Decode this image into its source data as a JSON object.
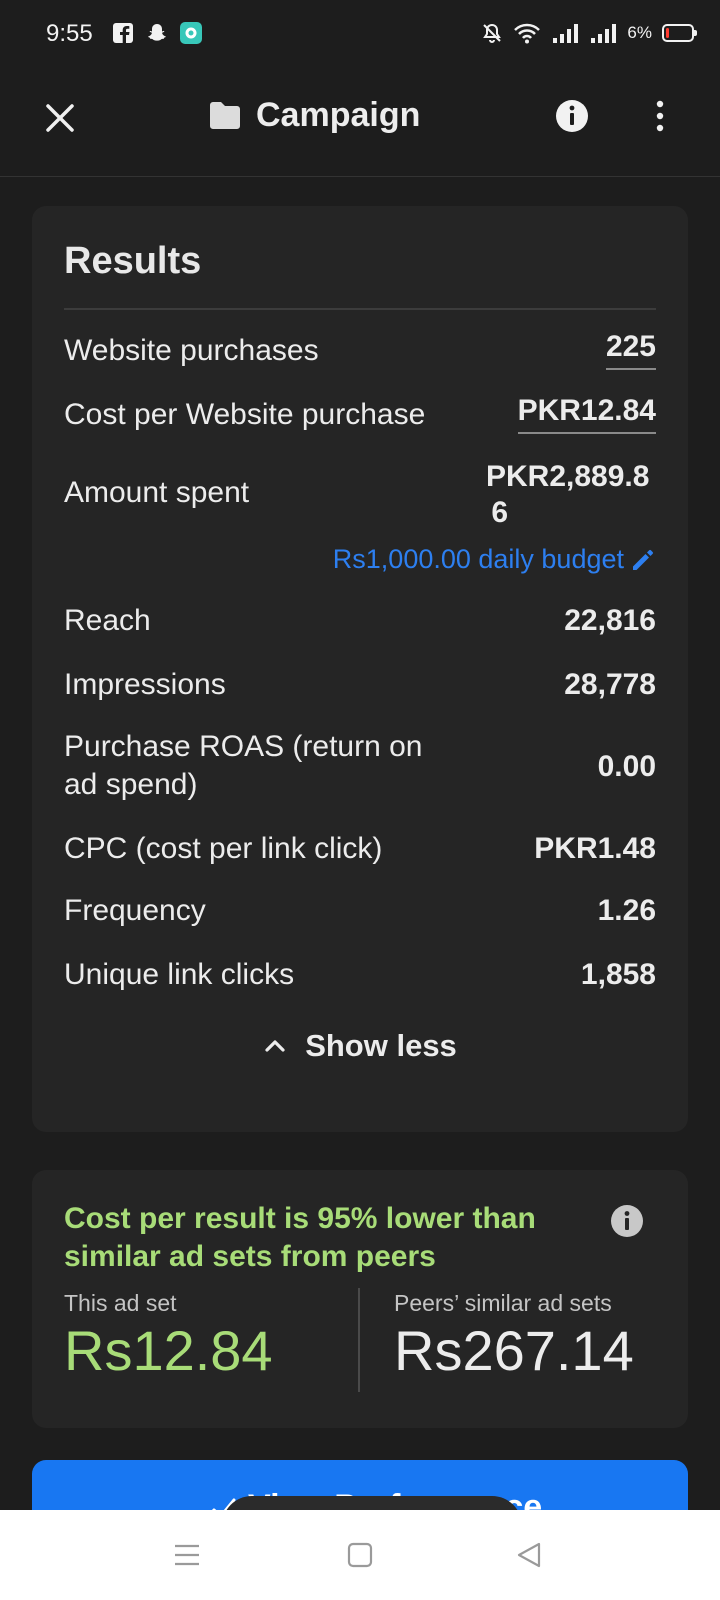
{
  "status_bar": {
    "time": "9:55",
    "battery": "6%"
  },
  "header": {
    "title": "Campaign"
  },
  "results": {
    "title": "Results",
    "rows": [
      {
        "label": "Website purchases",
        "value": "225"
      },
      {
        "label": "Cost per Website purchase",
        "value": "PKR12.84"
      },
      {
        "label": "Amount spent",
        "value_line1": "PKR2,889.8",
        "value_line2": "6",
        "budget": "Rs1,000.00 daily budget"
      },
      {
        "label": "Reach",
        "value": "22,816"
      },
      {
        "label": "Impressions",
        "value": "28,778"
      },
      {
        "label_line1": "Purchase ROAS (return on",
        "label_line2": "ad spend)",
        "value": "0.00"
      },
      {
        "label": "CPC (cost per link click)",
        "value": "PKR1.48"
      },
      {
        "label": "Frequency",
        "value": "1.26"
      },
      {
        "label": "Unique link clicks",
        "value": "1,858"
      }
    ],
    "show_less": "Show less"
  },
  "comparison": {
    "headline_line1": "Cost per result is 95% lower than",
    "headline_line2": "similar ad sets from peers",
    "this_label": "This ad set",
    "this_value": "Rs12.84",
    "peers_label": "Peers’ similar ad sets",
    "peers_value": "Rs267.14"
  },
  "perf_button": {
    "label": "View Performance"
  },
  "colors": {
    "accent_blue": "#1877f2",
    "link_blue": "#2d7ff0",
    "positive_green": "#a8dc78"
  }
}
